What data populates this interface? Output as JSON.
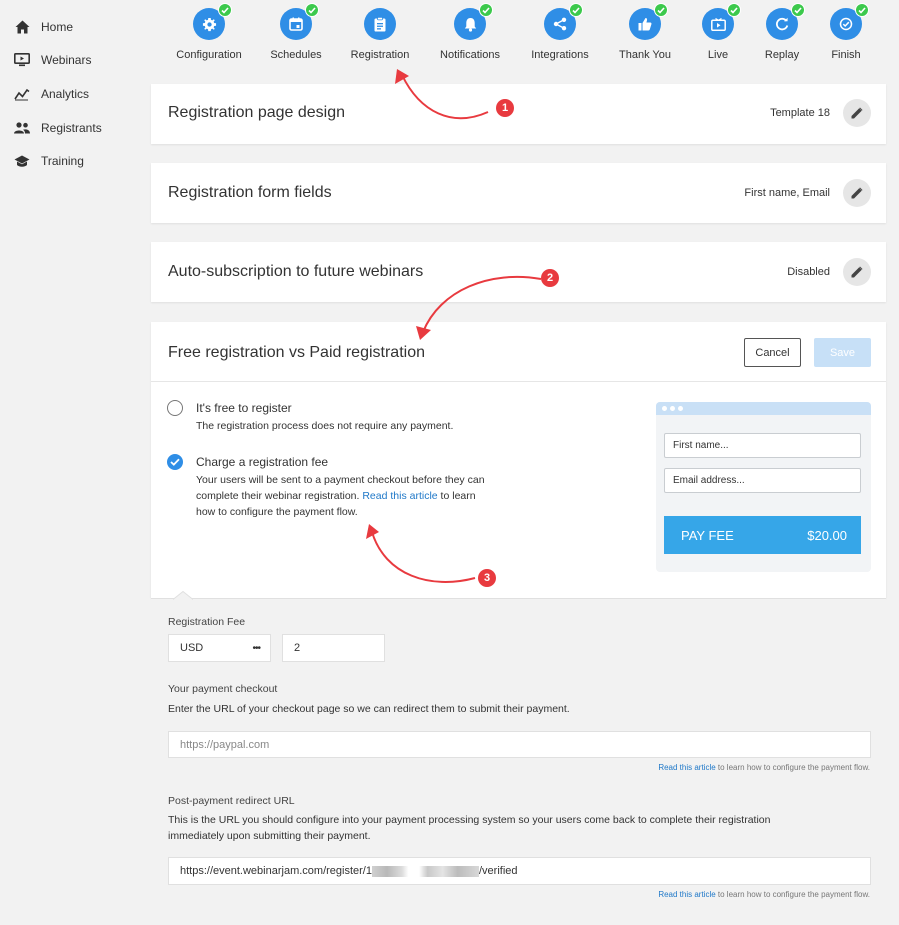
{
  "sidebar": {
    "items": [
      {
        "label": "Home",
        "icon": "home-icon"
      },
      {
        "label": "Webinars",
        "icon": "monitor-icon"
      },
      {
        "label": "Analytics",
        "icon": "analytics-icon"
      },
      {
        "label": "Registrants",
        "icon": "people-icon"
      },
      {
        "label": "Training",
        "icon": "graduation-cap-icon"
      }
    ]
  },
  "steps": [
    {
      "label": "Configuration",
      "icon": "gear-icon",
      "completed": true
    },
    {
      "label": "Schedules",
      "icon": "calendar-icon",
      "completed": true
    },
    {
      "label": "Registration",
      "icon": "clipboard-icon",
      "completed": false
    },
    {
      "label": "Notifications",
      "icon": "bell-icon",
      "completed": true
    },
    {
      "label": "Integrations",
      "icon": "share-icon",
      "completed": true
    },
    {
      "label": "Thank You",
      "icon": "thumbs-up-icon",
      "completed": true
    },
    {
      "label": "Live",
      "icon": "live-icon",
      "completed": true
    },
    {
      "label": "Replay",
      "icon": "replay-icon",
      "completed": true
    },
    {
      "label": "Finish",
      "icon": "check-circle-icon",
      "completed": true
    }
  ],
  "design": {
    "title": "Registration page design",
    "value": "Template 18"
  },
  "form_fields": {
    "title": "Registration form fields",
    "value": "First name, Email"
  },
  "auto_sub": {
    "title": "Auto-subscription to future webinars",
    "value": "Disabled"
  },
  "paid": {
    "title": "Free registration vs Paid registration",
    "cancel_label": "Cancel",
    "save_label": "Save",
    "free_option": {
      "title": "It's free to register",
      "desc": "The registration process does not require any payment.",
      "selected": false
    },
    "fee_option": {
      "title": "Charge a registration fee",
      "desc_line1": "Your users will be sent to a payment checkout before they can",
      "desc_line2_pre": "complete their webinar registration. ",
      "desc_link": "Read this article",
      "desc_line2_post": " to learn",
      "desc_line3": "how to configure the payment flow.",
      "selected": true
    },
    "preview": {
      "first_name_placeholder": "First name...",
      "email_placeholder": "Email address...",
      "pay_label": "PAY FEE",
      "pay_amount": "$20.00"
    }
  },
  "payment": {
    "fee_label": "Registration Fee",
    "currency": "USD",
    "currency_menu": "•••",
    "amount": "2",
    "checkout_label": "Your payment checkout",
    "checkout_desc": "Enter the URL of your checkout page so we can redirect them to submit their payment.",
    "checkout_placeholder": "https://paypal.com",
    "help_link": "Read this article",
    "help_text": " to learn how to configure the payment flow.",
    "redirect_label": "Post-payment redirect URL",
    "redirect_desc_line1": "This is the URL you should configure into your payment processing system so your users come back to complete their registration",
    "redirect_desc_line2": "immediately upon submitting their payment.",
    "redirect_url_start": "https://event.webinarjam.com/register/1",
    "redirect_url_end": "/verified"
  },
  "annotations": [
    "1",
    "2",
    "3"
  ],
  "colors": {
    "accent": "#2f8ee6",
    "success": "#3cc94c",
    "annotation": "#e83a3f",
    "pay_button": "#36a6e8"
  }
}
